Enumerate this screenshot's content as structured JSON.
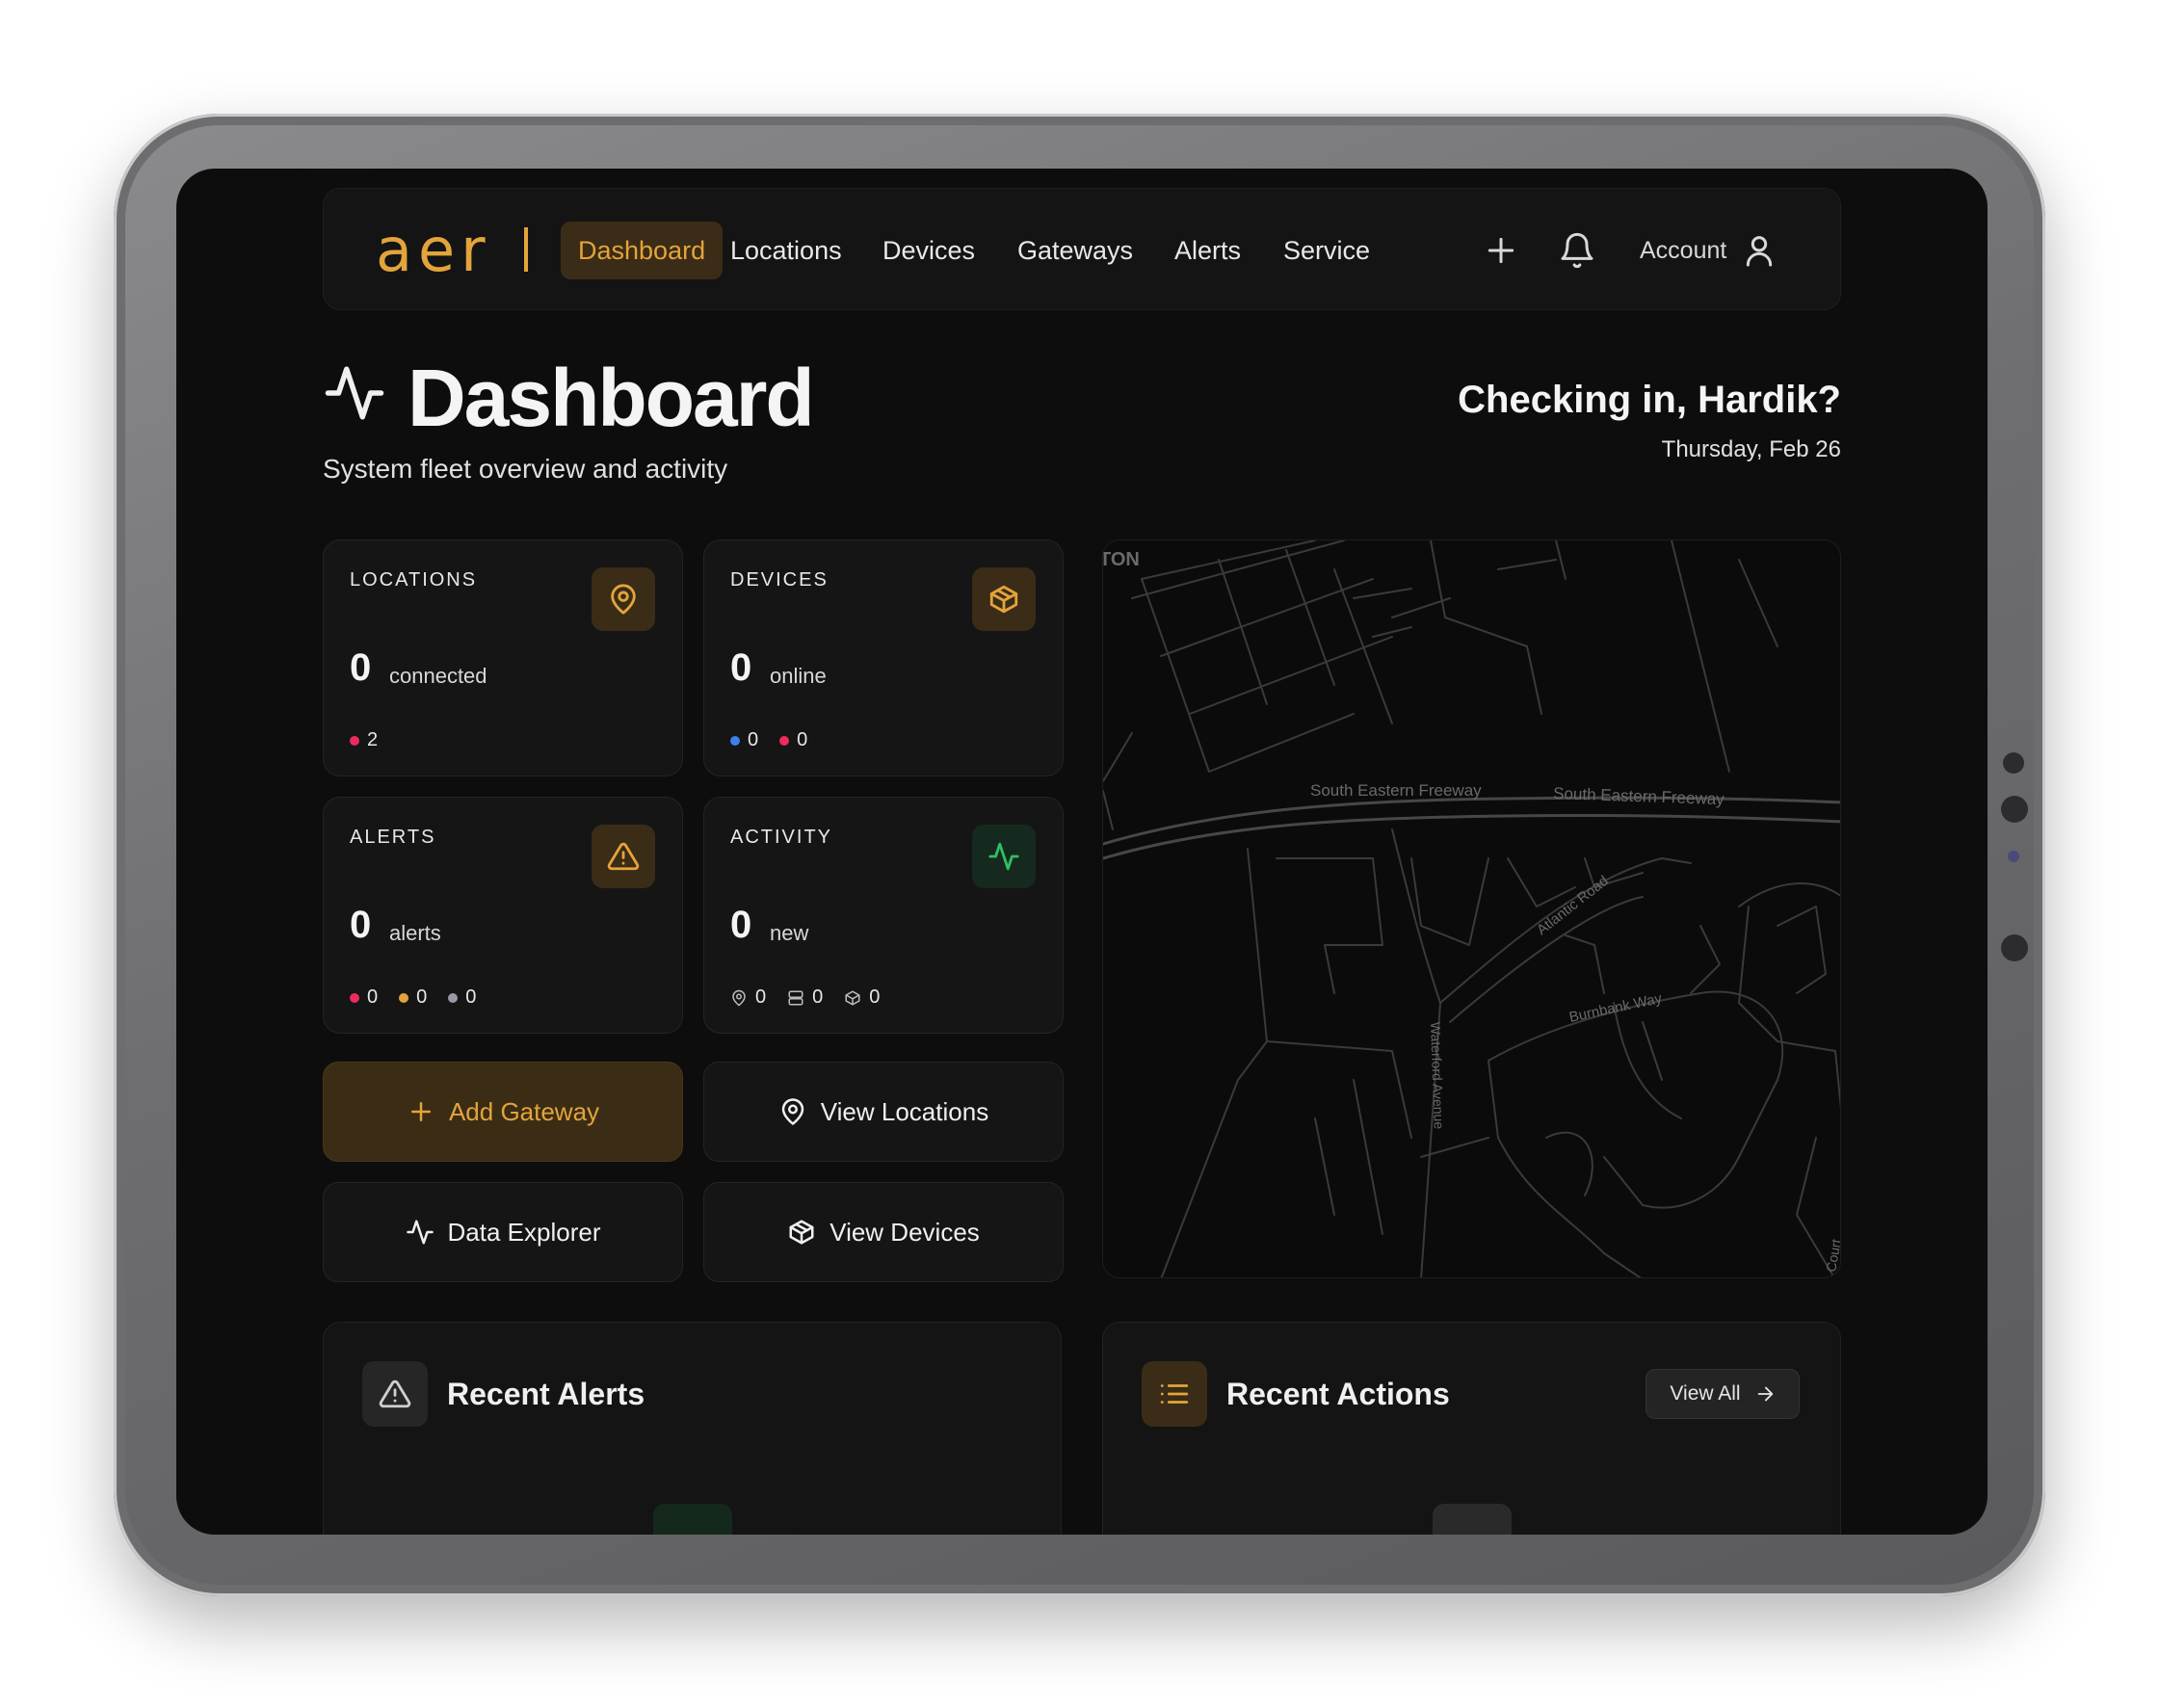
{
  "nav": {
    "logo": "aer",
    "items": [
      {
        "label": "Dashboard",
        "active": true
      },
      {
        "label": "Locations",
        "active": false
      },
      {
        "label": "Devices",
        "active": false
      },
      {
        "label": "Gateways",
        "active": false
      },
      {
        "label": "Alerts",
        "active": false
      },
      {
        "label": "Service",
        "active": false
      }
    ],
    "add_icon": "plus-icon",
    "bell_icon": "bell-icon",
    "account_label": "Account",
    "account_icon": "user-icon"
  },
  "header": {
    "title": "Dashboard",
    "subtitle": "System fleet overview and activity",
    "greeting": "Checking in, Hardik?",
    "date": "Thursday, Feb 26"
  },
  "cards": {
    "locations": {
      "label": "LOCATIONS",
      "value": "0",
      "unit": "connected",
      "sub": [
        "2"
      ],
      "icon": "map-pin-icon"
    },
    "devices": {
      "label": "DEVICES",
      "value": "0",
      "unit": "online",
      "sub": [
        "0",
        "0"
      ],
      "icon": "package-icon"
    },
    "alerts": {
      "label": "ALERTS",
      "value": "0",
      "unit": "alerts",
      "sub": [
        "0",
        "0",
        "0"
      ],
      "icon": "warning-icon"
    },
    "activity": {
      "label": "ACTIVITY",
      "value": "0",
      "unit": "new",
      "sub": [
        "0",
        "0",
        "0"
      ],
      "icon": "activity-icon"
    }
  },
  "actions": {
    "add_gateway": "Add Gateway",
    "view_locations": "View Locations",
    "data_explorer": "Data Explorer",
    "view_devices": "View Devices"
  },
  "map": {
    "labels": {
      "top_left": "TON",
      "freeway_1": "South Eastern Freeway",
      "freeway_2": "South Eastern Freeway",
      "road_1": "Atlantic Road",
      "road_2": "Burnbank Way",
      "road_3": "Waterford Avenue",
      "road_4": "Court"
    }
  },
  "panels": {
    "recent_alerts": {
      "title": "Recent Alerts"
    },
    "recent_actions": {
      "title": "Recent Actions",
      "view_all": "View All"
    }
  },
  "colors": {
    "accent": "#e3a43b",
    "danger": "#ee2b5e",
    "info": "#3f7fe8",
    "muted": "#9a9aa6",
    "success": "#2fbf66"
  }
}
